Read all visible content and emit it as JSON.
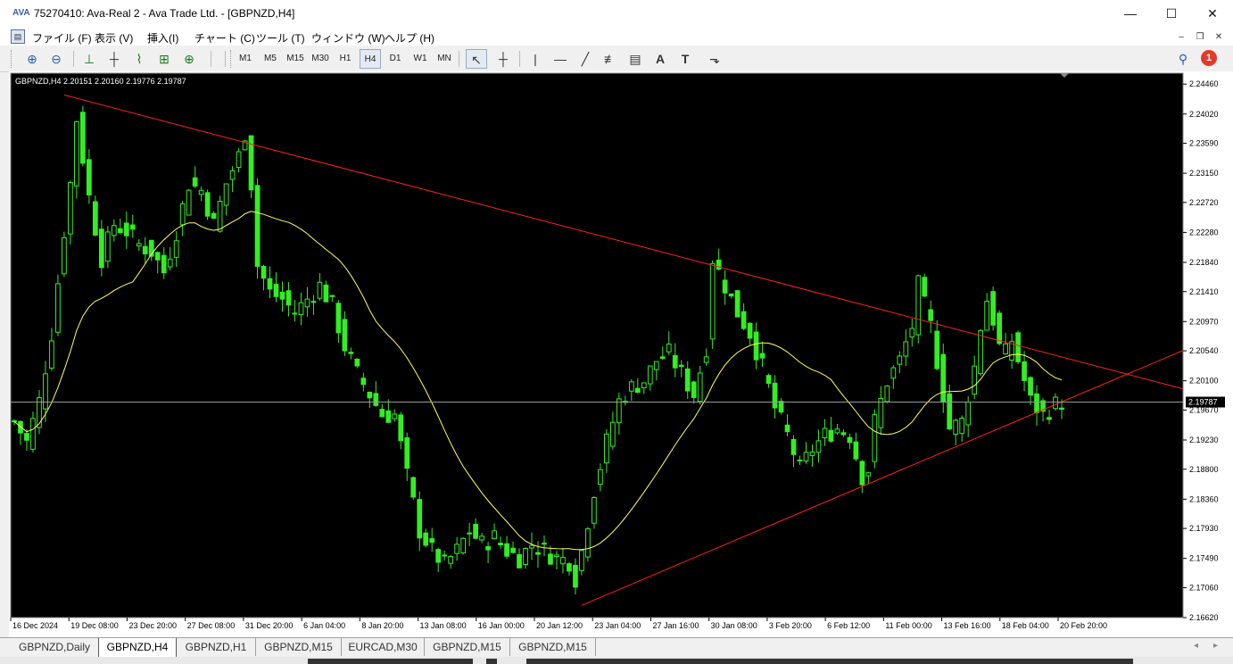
{
  "window": {
    "title": "75270410: Ava-Real 2 - Ava Trade Ltd. - [GBPNZD,H4]",
    "logo": "AVA",
    "minimize": "—",
    "maximize": "☐",
    "close": "✕"
  },
  "menu": {
    "items": [
      {
        "label": "ファイル (F)"
      },
      {
        "label": "表示 (V)"
      },
      {
        "label": "挿入(I)"
      },
      {
        "label": "チャート (C)"
      },
      {
        "label": "ツール (T)"
      },
      {
        "label": "ウィンドウ (W)"
      },
      {
        "label": "ヘルプ (H)"
      }
    ],
    "mdi_min": "–",
    "mdi_restore": "❐",
    "mdi_close": "✕"
  },
  "toolbar": {
    "timeframes": [
      "M1",
      "M5",
      "M15",
      "M30",
      "H1",
      "H4",
      "D1",
      "W1",
      "MN"
    ],
    "active_timeframe": "H4",
    "tools": {
      "zoom_in": "⊕",
      "zoom_out": "⊖",
      "bar_chart": "⊥",
      "candles": "┼",
      "line_chart": "⌇",
      "autoscroll": "⊞",
      "new_order": "⊕",
      "cursor": "↖",
      "crosshair": "┼",
      "vline": "|",
      "hline": "—",
      "trendline": "╱",
      "channel": "≢",
      "fibo": "▤",
      "text": "A",
      "label": "T",
      "arrows": "⬎"
    },
    "notification_count": "1"
  },
  "chart": {
    "header": "GBPNZD,H4  2.20151 2.20160 2.19776 2.19787",
    "symbol": "GBPNZD,H4",
    "current_price": "2.19787",
    "background": "#000000",
    "candle_color": "#33ee22",
    "ma_color": "#ffff55",
    "trendline_color": "#ff2020"
  },
  "chart_data": {
    "type": "candlestick",
    "symbol": "GBPNZD",
    "timeframe": "H4",
    "y_ticks": [
      "2.24460",
      "2.24020",
      "2.23590",
      "2.23150",
      "2.22720",
      "2.22280",
      "2.21840",
      "2.21410",
      "2.20970",
      "2.20540",
      "2.20100",
      "2.19670",
      "2.19230",
      "2.18800",
      "2.18360",
      "2.17930",
      "2.17490",
      "2.17060",
      "2.16620"
    ],
    "ylim": [
      2.1662,
      2.2462
    ],
    "x_ticks": [
      "16 Dec 2024",
      "19 Dec 08:00",
      "23 Dec 20:00",
      "27 Dec 08:00",
      "31 Dec 20:00",
      "6 Jan 04:00",
      "8 Jan 20:00",
      "13 Jan 08:00",
      "16 Jan 00:00",
      "20 Jan 12:00",
      "23 Jan 04:00",
      "27 Jan 16:00",
      "30 Jan 08:00",
      "3 Feb 20:00",
      "6 Feb 12:00",
      "11 Feb 00:00",
      "13 Feb 16:00",
      "18 Feb 04:00",
      "20 Feb 20:00"
    ],
    "close_path": [
      [
        0,
        2.195
      ],
      [
        2,
        2.192
      ],
      [
        4,
        2.198
      ],
      [
        6,
        2.208
      ],
      [
        8,
        2.223
      ],
      [
        9,
        2.23
      ],
      [
        10,
        2.2395
      ],
      [
        12,
        2.228
      ],
      [
        14,
        2.219
      ],
      [
        16,
        2.224
      ],
      [
        18,
        2.223
      ],
      [
        20,
        2.221
      ],
      [
        22,
        2.22
      ],
      [
        24,
        2.217
      ],
      [
        26,
        2.223
      ],
      [
        28,
        2.23
      ],
      [
        30,
        2.229
      ],
      [
        32,
        2.224
      ],
      [
        34,
        2.23
      ],
      [
        36,
        2.234
      ],
      [
        37,
        2.2375
      ],
      [
        38,
        2.23
      ],
      [
        39,
        2.218
      ],
      [
        41,
        2.214
      ],
      [
        43,
        2.213
      ],
      [
        45,
        2.211
      ],
      [
        47,
        2.213
      ],
      [
        49,
        2.215
      ],
      [
        51,
        2.212
      ],
      [
        53,
        2.206
      ],
      [
        55,
        2.202
      ],
      [
        57,
        2.199
      ],
      [
        59,
        2.196
      ],
      [
        61,
        2.196
      ],
      [
        63,
        2.187
      ],
      [
        65,
        2.179
      ],
      [
        67,
        2.176
      ],
      [
        69,
        2.174
      ],
      [
        71,
        2.176
      ],
      [
        73,
        2.179
      ],
      [
        75,
        2.177
      ],
      [
        77,
        2.178
      ],
      [
        79,
        2.176
      ],
      [
        81,
        2.175
      ],
      [
        83,
        2.177
      ],
      [
        85,
        2.176
      ],
      [
        87,
        2.175
      ],
      [
        89,
        2.1745
      ],
      [
        90,
        2.172
      ],
      [
        91,
        2.176
      ],
      [
        93,
        2.185
      ],
      [
        95,
        2.192
      ],
      [
        97,
        2.198
      ],
      [
        99,
        2.2
      ],
      [
        101,
        2.201
      ],
      [
        103,
        2.204
      ],
      [
        105,
        2.205
      ],
      [
        107,
        2.202
      ],
      [
        109,
        2.199
      ],
      [
        111,
        2.206
      ],
      [
        112,
        2.219
      ],
      [
        114,
        2.215
      ],
      [
        116,
        2.211
      ],
      [
        118,
        2.208
      ],
      [
        120,
        2.203
      ],
      [
        122,
        2.197
      ],
      [
        124,
        2.193
      ],
      [
        126,
        2.188
      ],
      [
        128,
        2.191
      ],
      [
        130,
        2.193
      ],
      [
        132,
        2.194
      ],
      [
        134,
        2.193
      ],
      [
        136,
        2.187
      ],
      [
        137,
        2.188
      ],
      [
        138,
        2.195
      ],
      [
        140,
        2.201
      ],
      [
        142,
        2.204
      ],
      [
        144,
        2.209
      ],
      [
        145,
        2.215
      ],
      [
        147,
        2.209
      ],
      [
        148,
        2.204
      ],
      [
        149,
        2.199
      ],
      [
        150,
        2.194
      ],
      [
        152,
        2.195
      ],
      [
        154,
        2.203
      ],
      [
        155,
        2.209
      ],
      [
        156,
        2.213
      ],
      [
        157,
        2.21
      ],
      [
        158,
        2.206
      ],
      [
        159,
        2.205
      ],
      [
        160,
        2.207
      ],
      [
        161,
        2.204
      ],
      [
        163,
        2.198
      ],
      [
        165,
        2.196
      ],
      [
        167,
        2.1975
      ],
      [
        168,
        2.1979
      ]
    ],
    "n_bars": 169,
    "ma_period": 20,
    "trendlines": [
      {
        "from": [
          8,
          2.243
        ],
        "to": [
          168,
          2.2045
        ],
        "extend": "right"
      },
      {
        "from": [
          91,
          2.168
        ],
        "to": [
          168,
          2.1979
        ],
        "extend": "right"
      }
    ]
  },
  "tabs": [
    {
      "label": "GBPNZD,Daily"
    },
    {
      "label": "GBPNZD,H4"
    },
    {
      "label": "GBPNZD,H1"
    },
    {
      "label": "GBPNZD,M15"
    },
    {
      "label": "EURCAD,M30"
    },
    {
      "label": "GBPNZD,M15"
    },
    {
      "label": "GBPNZD,M15"
    }
  ],
  "active_tab": 1,
  "scroll": {
    "left": "◂",
    "right": "▸"
  }
}
